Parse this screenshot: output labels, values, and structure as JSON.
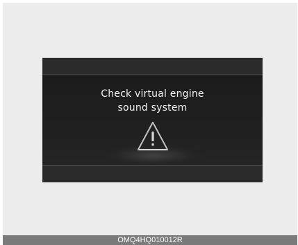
{
  "warning": {
    "line1": "Check virtual engine",
    "line2": "sound system",
    "icon": "warning-triangle-icon"
  },
  "footer": {
    "code": "OMQ4HQ010012R"
  },
  "colors": {
    "screen_bg": "#262626",
    "text": "#f2f2f2",
    "page_bg": "#ececec",
    "footer_bg": "#7a7a7a"
  }
}
